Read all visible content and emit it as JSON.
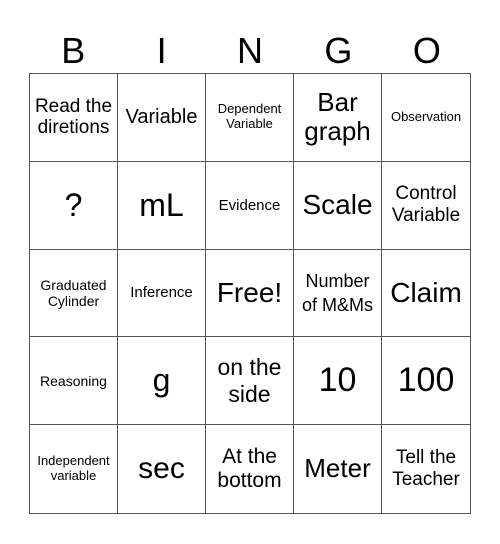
{
  "header": {
    "letters": [
      "B",
      "I",
      "N",
      "G",
      "O"
    ]
  },
  "card": {
    "rows": [
      [
        "Read the diretions",
        "Variable",
        "Dependent Variable",
        "Bar graph",
        "Observation"
      ],
      [
        "?",
        "mL",
        "Evidence",
        "Scale",
        "Control Variable"
      ],
      [
        "Graduated Cylinder",
        "Inference",
        "Free!",
        "Number of M&Ms",
        "Claim"
      ],
      [
        "Reasoning",
        "g",
        "on the side",
        "10",
        "100"
      ],
      [
        "Independent variable",
        "sec",
        "At the bottom",
        "Meter",
        "Tell the Teacher"
      ]
    ],
    "free_space": "Free!",
    "border_color": "#555555"
  }
}
